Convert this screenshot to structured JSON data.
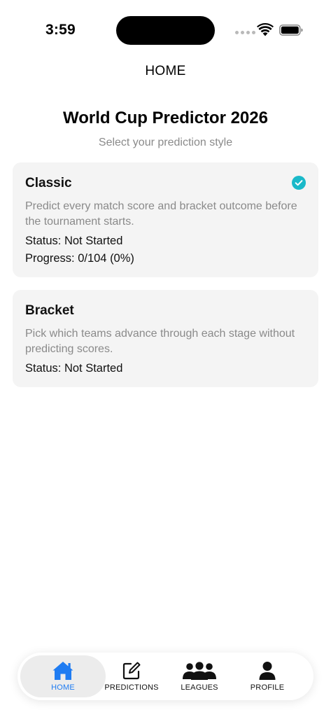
{
  "status_bar": {
    "time": "3:59"
  },
  "nav": {
    "title": "HOME"
  },
  "header": {
    "title": "World Cup Predictor 2026",
    "subtitle": "Select your prediction style"
  },
  "cards": [
    {
      "title": "Classic",
      "description": "Predict every match score and bracket outcome before the tournament starts.",
      "status": "Status: Not Started",
      "progress": "Progress: 0/104 (0%)",
      "selected": true
    },
    {
      "title": "Bracket",
      "description": "Pick which teams advance through each stage without predicting scores.",
      "status": "Status: Not Started",
      "selected": false
    }
  ],
  "tabs": [
    {
      "label": "HOME",
      "icon": "house-icon",
      "active": true
    },
    {
      "label": "PREDICTIONS",
      "icon": "edit-icon",
      "active": false
    },
    {
      "label": "LEAGUES",
      "icon": "group-icon",
      "active": false
    },
    {
      "label": "PROFILE",
      "icon": "person-icon",
      "active": false
    }
  ],
  "colors": {
    "accent": "#1f7cf2",
    "check": "#1ab9c9",
    "card_bg": "#f4f4f4",
    "muted_text": "#8a8a8a"
  }
}
